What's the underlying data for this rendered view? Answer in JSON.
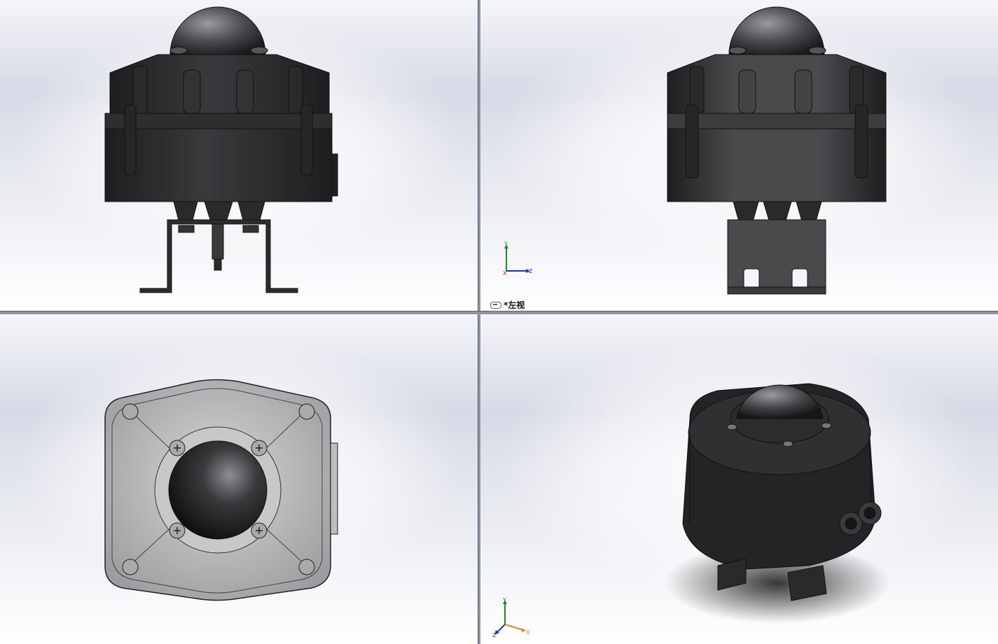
{
  "views": {
    "front": {
      "name": "front-view"
    },
    "left": {
      "name": "left-view",
      "label": "*左视"
    },
    "top": {
      "name": "top-view"
    },
    "iso": {
      "name": "isometric-view"
    }
  },
  "triads": {
    "left": {
      "up": "Y",
      "right": "Z",
      "origin": "X"
    },
    "iso": {
      "up": "Y",
      "right": "X",
      "origin": "Z"
    }
  },
  "colors": {
    "body_dark": "#2a2a2c",
    "body_mid": "#3c3c3f",
    "top_gray": "#b4b4b6",
    "axis_y": "#1f8a2a",
    "axis_z": "#2233cc",
    "axis_x": "#cc2222",
    "axis_x_iso": "#e08a1c"
  },
  "icons": {
    "view_link": "link-icon"
  }
}
